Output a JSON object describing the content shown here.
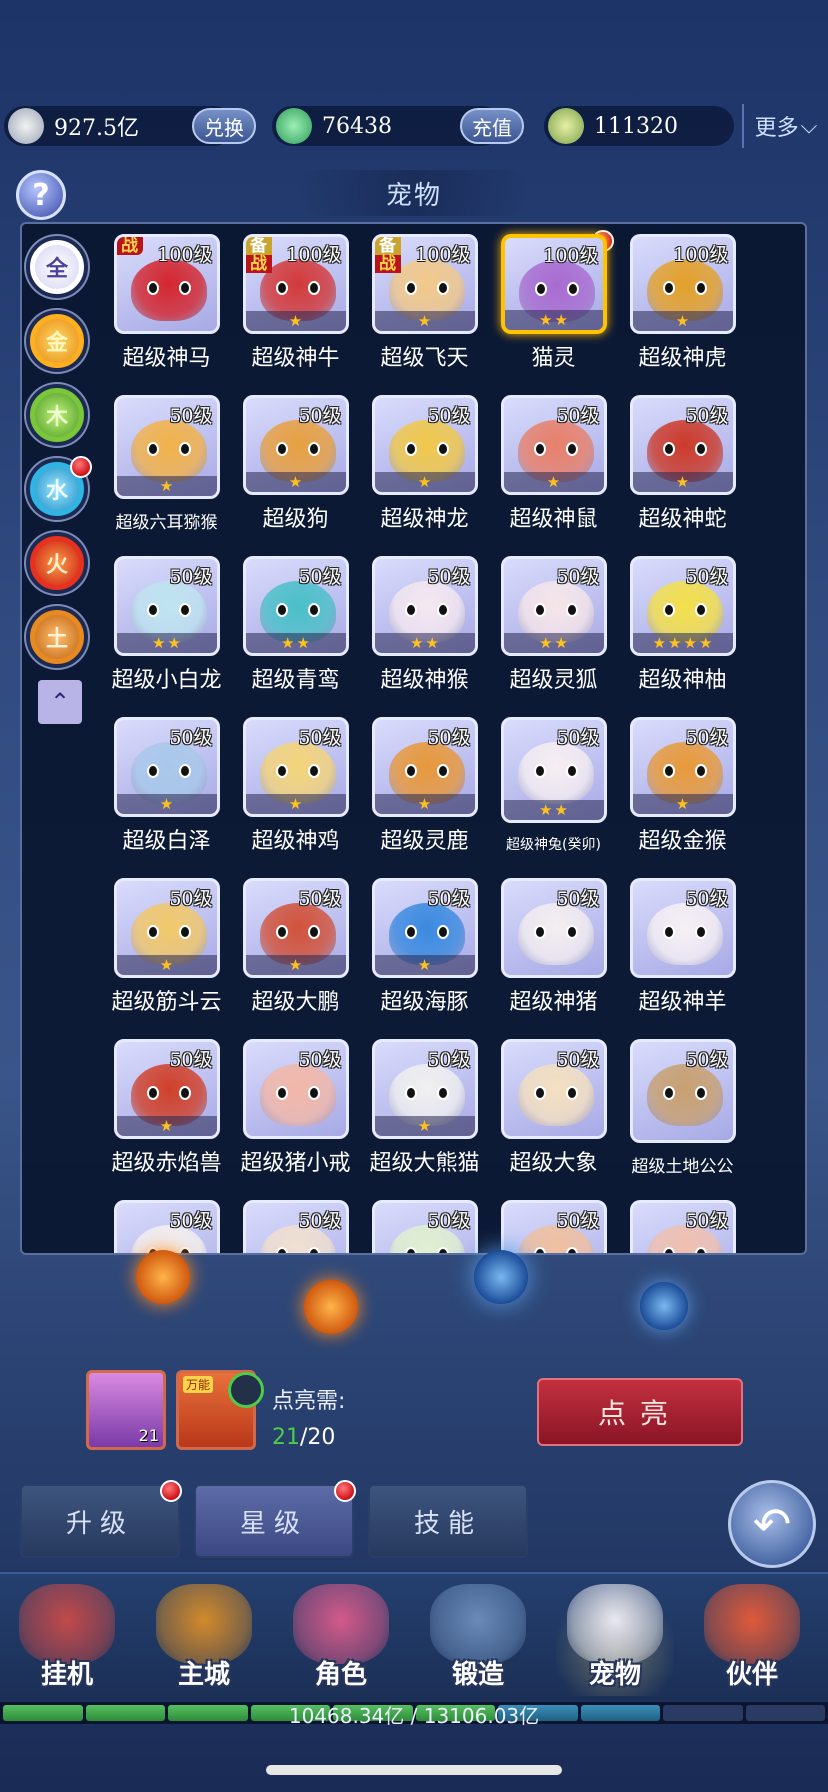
{
  "currency": {
    "silver": "927.5亿",
    "exchange_label": "兑换",
    "jade": "76438",
    "recharge_label": "充值",
    "coupon": "111320",
    "more_label": "更多"
  },
  "panel": {
    "help": "?",
    "title": "宠物",
    "filters": [
      "全",
      "金",
      "木",
      "水",
      "火",
      "土"
    ]
  },
  "pets": [
    {
      "name": "超级神马",
      "level": "100级",
      "stars": 0,
      "tag": "战",
      "tag2": "",
      "color": "#d4262e"
    },
    {
      "name": "超级神牛",
      "level": "100级",
      "stars": 1,
      "tag": "备",
      "tag2": "战",
      "color": "#d33a3a"
    },
    {
      "name": "超级飞天",
      "level": "100级",
      "stars": 1,
      "tag": "备",
      "tag2": "战",
      "color": "#f2c98a"
    },
    {
      "name": "猫灵",
      "level": "100级",
      "stars": 2,
      "tag": "",
      "tag2": "",
      "color": "#a86bd0"
    },
    {
      "name": "超级神虎",
      "level": "100级",
      "stars": 1,
      "tag": "",
      "tag2": "",
      "color": "#e4a12a"
    },
    {
      "name": "超级六耳猕猴",
      "level": "50级",
      "stars": 1,
      "tag": "",
      "tag2": "",
      "color": "#f2b24a"
    },
    {
      "name": "超级狗",
      "level": "50级",
      "stars": 1,
      "tag": "",
      "tag2": "",
      "color": "#e8a040"
    },
    {
      "name": "超级神龙",
      "level": "50级",
      "stars": 1,
      "tag": "",
      "tag2": "",
      "color": "#f0c84a"
    },
    {
      "name": "超级神鼠",
      "level": "50级",
      "stars": 1,
      "tag": "",
      "tag2": "",
      "color": "#e8806a"
    },
    {
      "name": "超级神蛇",
      "level": "50级",
      "stars": 1,
      "tag": "",
      "tag2": "",
      "color": "#cc3a2a"
    },
    {
      "name": "超级小白龙",
      "level": "50级",
      "stars": 2,
      "tag": "",
      "tag2": "",
      "color": "#bfe4f0"
    },
    {
      "name": "超级青鸾",
      "level": "50级",
      "stars": 2,
      "tag": "",
      "tag2": "",
      "color": "#4ac0c8"
    },
    {
      "name": "超级神猴",
      "level": "50级",
      "stars": 2,
      "tag": "",
      "tag2": "",
      "color": "#f4e8f0"
    },
    {
      "name": "超级灵狐",
      "level": "50级",
      "stars": 2,
      "tag": "",
      "tag2": "",
      "color": "#f6e6ea"
    },
    {
      "name": "超级神柚",
      "level": "50级",
      "stars": 4,
      "tag": "",
      "tag2": "",
      "color": "#f4e04a"
    },
    {
      "name": "超级白泽",
      "level": "50级",
      "stars": 1,
      "tag": "",
      "tag2": "",
      "color": "#a8c8ea"
    },
    {
      "name": "超级神鸡",
      "level": "50级",
      "stars": 1,
      "tag": "",
      "tag2": "",
      "color": "#f4d47a"
    },
    {
      "name": "超级灵鹿",
      "level": "50级",
      "stars": 1,
      "tag": "",
      "tag2": "",
      "color": "#e8983a"
    },
    {
      "name": "超级神兔(癸卯)",
      "level": "50级",
      "stars": 2,
      "tag": "",
      "tag2": "",
      "color": "#f6eef2"
    },
    {
      "name": "超级金猴",
      "level": "50级",
      "stars": 1,
      "tag": "",
      "tag2": "",
      "color": "#e89a3a"
    },
    {
      "name": "超级筋斗云",
      "level": "50级",
      "stars": 1,
      "tag": "",
      "tag2": "",
      "color": "#f2c86a"
    },
    {
      "name": "超级大鹏",
      "level": "50级",
      "stars": 1,
      "tag": "",
      "tag2": "",
      "color": "#d2523a"
    },
    {
      "name": "超级海豚",
      "level": "50级",
      "stars": 1,
      "tag": "",
      "tag2": "",
      "color": "#3a8ae0"
    },
    {
      "name": "超级神猪",
      "level": "50级",
      "stars": 0,
      "tag": "",
      "tag2": "",
      "color": "#f4eef0"
    },
    {
      "name": "超级神羊",
      "level": "50级",
      "stars": 0,
      "tag": "",
      "tag2": "",
      "color": "#f6f0f4"
    },
    {
      "name": "超级赤焰兽",
      "level": "50级",
      "stars": 1,
      "tag": "",
      "tag2": "",
      "color": "#d0402a"
    },
    {
      "name": "超级猪小戒",
      "level": "50级",
      "stars": 0,
      "tag": "",
      "tag2": "",
      "color": "#f2b8a8"
    },
    {
      "name": "超级大熊猫",
      "level": "50级",
      "stars": 1,
      "tag": "",
      "tag2": "",
      "color": "#f0f0f0"
    },
    {
      "name": "超级大象",
      "level": "50级",
      "stars": 0,
      "tag": "",
      "tag2": "",
      "color": "#f4e0c0"
    },
    {
      "name": "超级土地公公",
      "level": "50级",
      "stars": 0,
      "tag": "",
      "tag2": "",
      "color": "#c8a070"
    },
    {
      "name": "",
      "level": "50级",
      "stars": 0,
      "tag": "",
      "tag2": "",
      "color": "#f4f0f0"
    },
    {
      "name": "",
      "level": "50级",
      "stars": 0,
      "tag": "",
      "tag2": "",
      "color": "#f0e0d0"
    },
    {
      "name": "",
      "level": "50级",
      "stars": 0,
      "tag": "",
      "tag2": "",
      "color": "#e0f0d0"
    },
    {
      "name": "",
      "level": "50级",
      "stars": 0,
      "tag": "",
      "tag2": "",
      "color": "#f0c0a0"
    },
    {
      "name": "",
      "level": "50级",
      "stars": 0,
      "tag": "",
      "tag2": "",
      "color": "#f0c0b0"
    }
  ],
  "selected_index": 3,
  "light_up": {
    "gift_level": "21",
    "gift2_tag": "万能",
    "need_label": "点亮需:",
    "count_have": "21",
    "count_need": "/20",
    "button_label": "点亮"
  },
  "subtabs": [
    {
      "label": "升级",
      "dot": true
    },
    {
      "label": "星级",
      "dot": true
    },
    {
      "label": "技能",
      "dot": false
    }
  ],
  "back_icon": "undo-arrow-icon",
  "nav": [
    {
      "label": "挂机",
      "color": "#c24a4a"
    },
    {
      "label": "主城",
      "color": "#d28a2a"
    },
    {
      "label": "角色",
      "color": "#d45a8a"
    },
    {
      "label": "锻造",
      "color": "#6a8ab8"
    },
    {
      "label": "宠物",
      "color": "#e8e8f0"
    },
    {
      "label": "伙伴",
      "color": "#e05a3a"
    }
  ],
  "power": {
    "text": "10468.34亿 / 13106.03亿",
    "fraction": 0.8
  }
}
